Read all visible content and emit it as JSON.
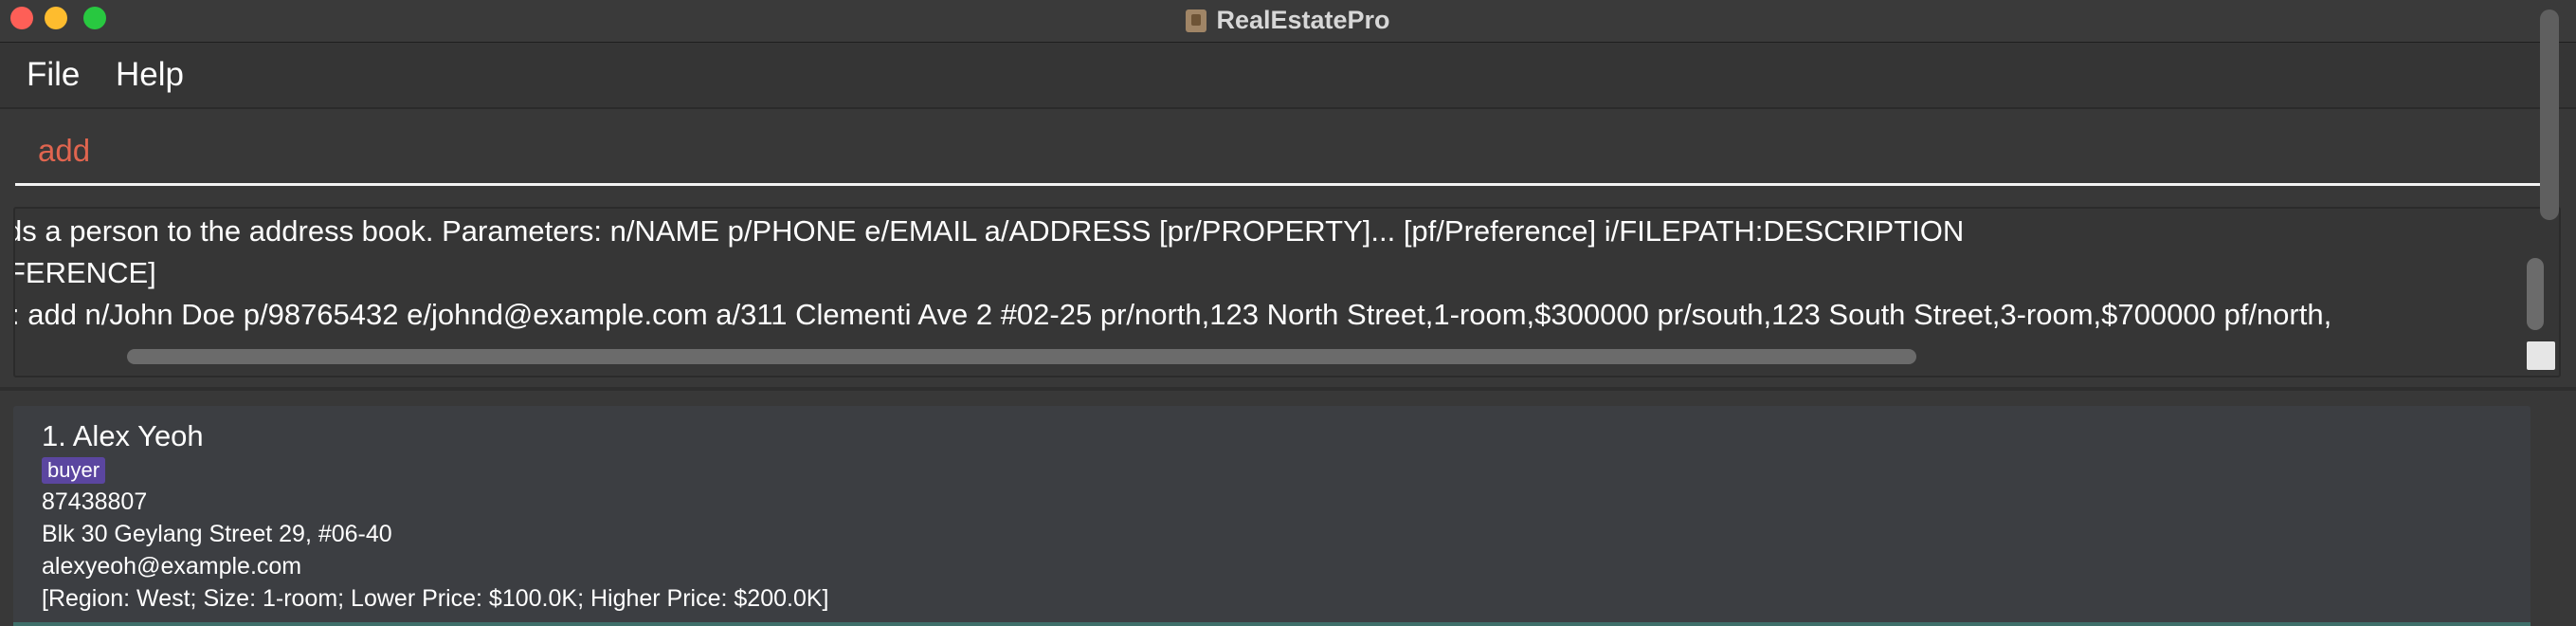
{
  "window": {
    "title": "RealEstatePro"
  },
  "menu": {
    "file": "File",
    "help": "Help"
  },
  "command": {
    "value": "add"
  },
  "result": {
    "lines": [
      "ds a person to the address book. Parameters: n/NAME p/PHONE e/EMAIL a/ADDRESS [pr/PROPERTY]... [pf/Preference] i/FILEPATH:DESCRIPTION",
      "FERENCE]",
      ": add n/John Doe p/98765432 e/johnd@example.com a/311 Clementi Ave 2 #02-25 pr/north,123 North Street,1-room,$300000 pr/south,123 South Street,3-room,$700000 pf/north,"
    ]
  },
  "persons": [
    {
      "index_name": "1.  Alex Yeoh",
      "tag": "buyer",
      "phone": "87438807",
      "address": "Blk 30 Geylang Street 29, #06-40",
      "email": "alexyeoh@example.com",
      "preference": "[Region: West; Size: 1-room; Lower Price: $100.0K; Higher Price: $200.0K]"
    }
  ]
}
